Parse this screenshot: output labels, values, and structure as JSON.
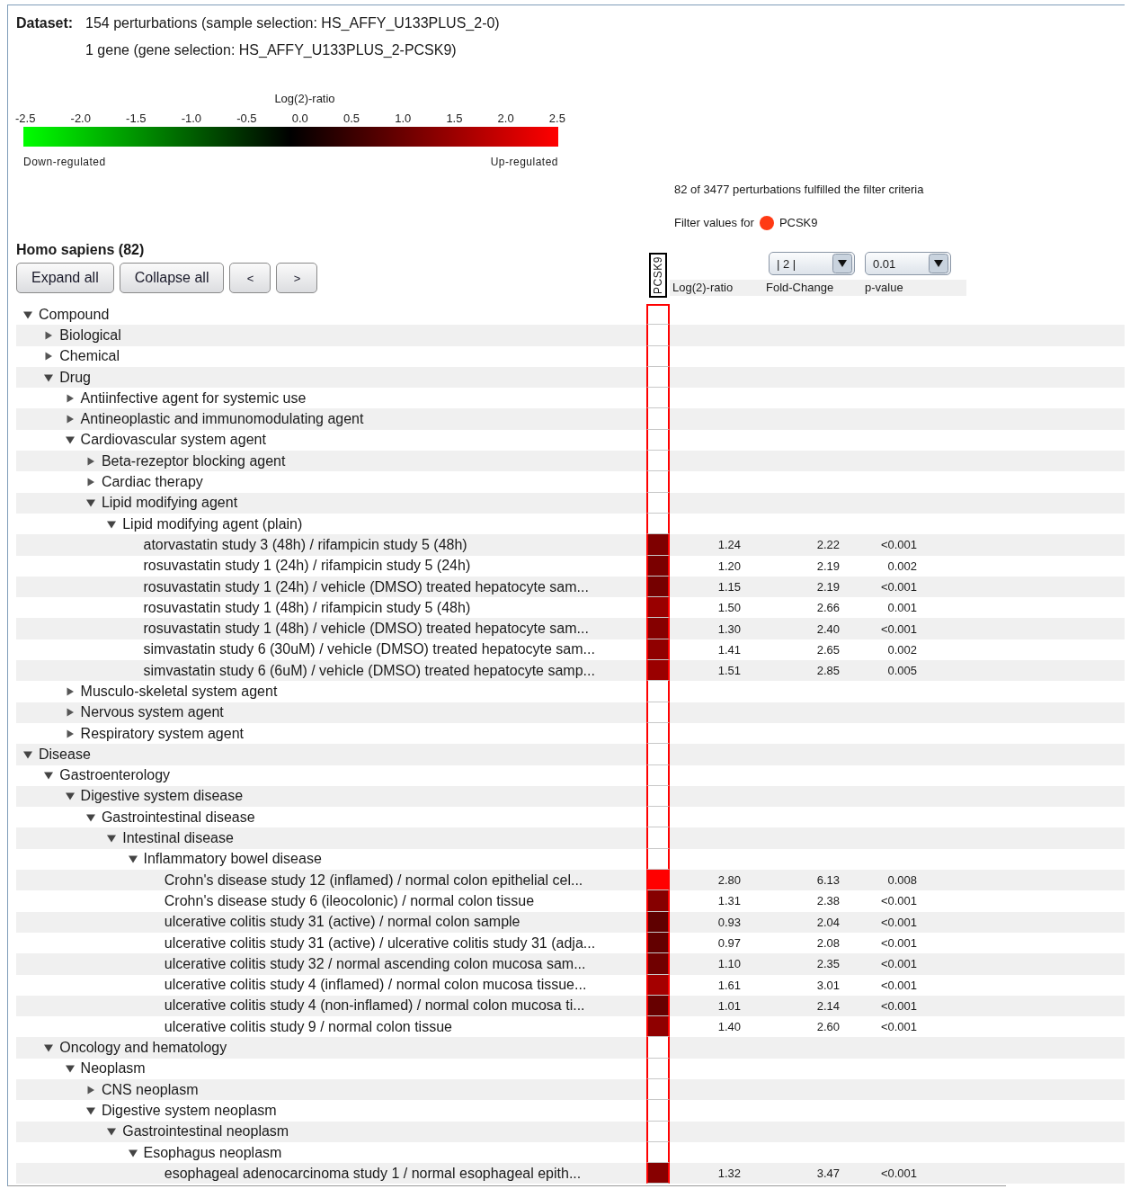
{
  "dataset": {
    "label": "Dataset:",
    "lines": [
      "154 perturbations (sample selection: HS_AFFY_U133PLUS_2-0)",
      "1 gene (gene selection: HS_AFFY_U133PLUS_2-PCSK9)"
    ]
  },
  "legend": {
    "title": "Log(2)-ratio",
    "ticks": [
      "-2.5",
      "-2.0",
      "-1.5",
      "-1.0",
      "-0.5",
      "0.0",
      "0.5",
      "1.0",
      "1.5",
      "2.0",
      "2.5"
    ],
    "low_label": "Down-regulated",
    "high_label": "Up-regulated"
  },
  "filter": {
    "summary": "82 of 3477 perturbations fulfilled the filter criteria",
    "label": "Filter values for",
    "gene": "PCSK9",
    "fold_change": "| 2 |",
    "p_value": "0.01"
  },
  "organism": "Homo sapiens (82)",
  "buttons": [
    "Expand all",
    "Collapse all",
    "<",
    ">"
  ],
  "gene_column": "PCSK9",
  "columns": [
    "Log(2)-ratio",
    "Fold-Change",
    "p-value"
  ],
  "tree": [
    {
      "kind": "group",
      "label": "Compound",
      "expanded": true,
      "children": [
        {
          "kind": "group",
          "label": "Biological",
          "expanded": false
        },
        {
          "kind": "group",
          "label": "Chemical",
          "expanded": false
        },
        {
          "kind": "group",
          "label": "Drug",
          "expanded": true,
          "children": [
            {
              "kind": "group",
              "label": "Antiinfective agent for systemic use",
              "expanded": false
            },
            {
              "kind": "group",
              "label": "Antineoplastic and immunomodulating agent",
              "expanded": false
            },
            {
              "kind": "group",
              "label": "Cardiovascular system agent",
              "expanded": true,
              "children": [
                {
                  "kind": "group",
                  "label": "Beta-rezeptor blocking agent",
                  "expanded": false
                },
                {
                  "kind": "group",
                  "label": "Cardiac therapy",
                  "expanded": false
                },
                {
                  "kind": "group",
                  "label": "Lipid modifying agent",
                  "expanded": true,
                  "children": [
                    {
                      "kind": "group",
                      "label": "Lipid modifying agent (plain)",
                      "expanded": true,
                      "children": [
                        {
                          "kind": "perturbation",
                          "label": "atorvastatin study 3 (48h) / rifampicin study 5 (48h)",
                          "log2_ratio": "1.24",
                          "fold_change": "2.22",
                          "p_value": "<0.001"
                        },
                        {
                          "kind": "perturbation",
                          "label": "rosuvastatin study 1 (24h) / rifampicin study 5 (24h)",
                          "log2_ratio": "1.20",
                          "fold_change": "2.19",
                          "p_value": "0.002"
                        },
                        {
                          "kind": "perturbation",
                          "label": "rosuvastatin study 1 (24h) / vehicle (DMSO) treated hepatocyte sam...",
                          "log2_ratio": "1.15",
                          "fold_change": "2.19",
                          "p_value": "<0.001"
                        },
                        {
                          "kind": "perturbation",
                          "label": "rosuvastatin study 1 (48h) / rifampicin study 5 (48h)",
                          "log2_ratio": "1.50",
                          "fold_change": "2.66",
                          "p_value": "0.001"
                        },
                        {
                          "kind": "perturbation",
                          "label": "rosuvastatin study 1 (48h) / vehicle (DMSO) treated hepatocyte sam...",
                          "log2_ratio": "1.30",
                          "fold_change": "2.40",
                          "p_value": "<0.001"
                        },
                        {
                          "kind": "perturbation",
                          "label": "simvastatin study 6 (30uM) / vehicle (DMSO) treated hepatocyte sam...",
                          "log2_ratio": "1.41",
                          "fold_change": "2.65",
                          "p_value": "0.002"
                        },
                        {
                          "kind": "perturbation",
                          "label": "simvastatin study 6 (6uM) / vehicle (DMSO) treated hepatocyte samp...",
                          "log2_ratio": "1.51",
                          "fold_change": "2.85",
                          "p_value": "0.005"
                        }
                      ]
                    }
                  ]
                }
              ]
            },
            {
              "kind": "group",
              "label": "Musculo-skeletal system agent",
              "expanded": false
            },
            {
              "kind": "group",
              "label": "Nervous system agent",
              "expanded": false
            },
            {
              "kind": "group",
              "label": "Respiratory system agent",
              "expanded": false
            }
          ]
        }
      ]
    },
    {
      "kind": "group",
      "label": "Disease",
      "expanded": true,
      "children": [
        {
          "kind": "group",
          "label": "Gastroenterology",
          "expanded": true,
          "children": [
            {
              "kind": "group",
              "label": "Digestive system disease",
              "expanded": true,
              "children": [
                {
                  "kind": "group",
                  "label": "Gastrointestinal disease",
                  "expanded": true,
                  "children": [
                    {
                      "kind": "group",
                      "label": "Intestinal disease",
                      "expanded": true,
                      "children": [
                        {
                          "kind": "group",
                          "label": "Inflammatory bowel disease",
                          "expanded": true,
                          "children": [
                            {
                              "kind": "perturbation",
                              "label": "Crohn's disease study 12 (inflamed) / normal colon epithelial cel...",
                              "log2_ratio": "2.80",
                              "fold_change": "6.13",
                              "p_value": "0.008"
                            },
                            {
                              "kind": "perturbation",
                              "label": "Crohn's disease study 6 (ileocolonic) / normal colon tissue",
                              "log2_ratio": "1.31",
                              "fold_change": "2.38",
                              "p_value": "<0.001"
                            },
                            {
                              "kind": "perturbation",
                              "label": "ulcerative colitis study 31 (active) / normal colon sample",
                              "log2_ratio": "0.93",
                              "fold_change": "2.04",
                              "p_value": "<0.001"
                            },
                            {
                              "kind": "perturbation",
                              "label": "ulcerative colitis study 31 (active) / ulcerative colitis study 31 (adja...",
                              "log2_ratio": "0.97",
                              "fold_change": "2.08",
                              "p_value": "<0.001"
                            },
                            {
                              "kind": "perturbation",
                              "label": "ulcerative colitis study 32 / normal ascending colon mucosa sam...",
                              "log2_ratio": "1.10",
                              "fold_change": "2.35",
                              "p_value": "<0.001"
                            },
                            {
                              "kind": "perturbation",
                              "label": "ulcerative colitis study 4 (inflamed) / normal colon mucosa tissue...",
                              "log2_ratio": "1.61",
                              "fold_change": "3.01",
                              "p_value": "<0.001"
                            },
                            {
                              "kind": "perturbation",
                              "label": "ulcerative colitis study 4 (non-inflamed) / normal colon mucosa ti...",
                              "log2_ratio": "1.01",
                              "fold_change": "2.14",
                              "p_value": "<0.001"
                            },
                            {
                              "kind": "perturbation",
                              "label": "ulcerative colitis study 9 / normal colon tissue",
                              "log2_ratio": "1.40",
                              "fold_change": "2.60",
                              "p_value": "<0.001"
                            }
                          ]
                        }
                      ]
                    }
                  ]
                }
              ]
            }
          ]
        },
        {
          "kind": "group",
          "label": "Oncology and hematology",
          "expanded": true,
          "children": [
            {
              "kind": "group",
              "label": "Neoplasm",
              "expanded": true,
              "children": [
                {
                  "kind": "group",
                  "label": "CNS neoplasm",
                  "expanded": false
                },
                {
                  "kind": "group",
                  "label": "Digestive system neoplasm",
                  "expanded": true,
                  "children": [
                    {
                      "kind": "group",
                      "label": "Gastrointestinal neoplasm",
                      "expanded": true,
                      "children": [
                        {
                          "kind": "group",
                          "label": "Esophagus neoplasm",
                          "expanded": true,
                          "children": [
                            {
                              "kind": "perturbation",
                              "label": "esophageal adenocarcinoma study 1 / normal esophageal epith...",
                              "log2_ratio": "1.32",
                              "fold_change": "3.47",
                              "p_value": "<0.001"
                            }
                          ]
                        }
                      ]
                    }
                  ]
                }
              ]
            }
          ]
        }
      ]
    }
  ]
}
